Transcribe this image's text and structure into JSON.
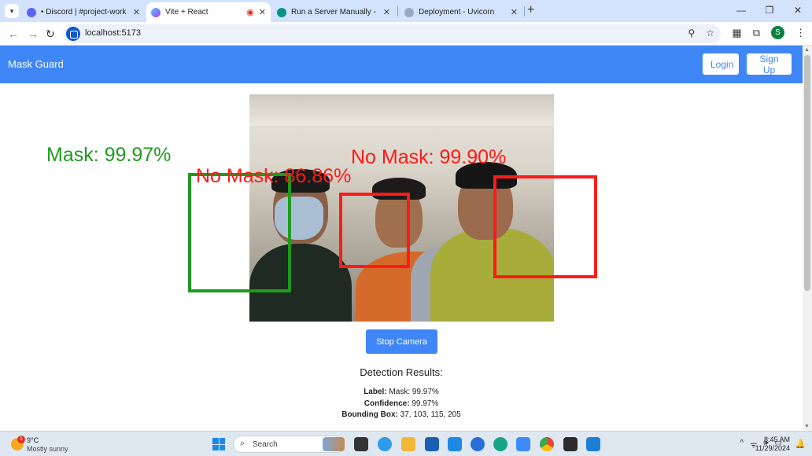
{
  "browser": {
    "tabs": [
      {
        "title": "• Discord | #project-work | SWE",
        "active": false
      },
      {
        "title": "Vite + React",
        "active": true
      },
      {
        "title": "Run a Server Manually - FastAPI",
        "active": false
      },
      {
        "title": "Deployment - Uvicorn",
        "active": false
      }
    ],
    "url": "localhost:5173",
    "profile_initial": "S"
  },
  "app": {
    "brand": "Mask Guard",
    "login_label": "Login",
    "signup_label": "Sign Up",
    "detections": [
      {
        "text": "Mask: 99.97%",
        "color": "#1f9a1f"
      },
      {
        "text": "No Mask: 86.86%",
        "color": "#ff1a1a"
      },
      {
        "text": "No Mask: 99.90%",
        "color": "#ff1a1a"
      }
    ],
    "stop_label": "Stop Camera",
    "results": {
      "title": "Detection Results:",
      "label_key": "Label:",
      "label_value": "Mask: 99.97%",
      "confidence_key": "Confidence:",
      "confidence_value": "99.97%",
      "bbox_key": "Bounding Box:",
      "bbox_value": "37, 103, 115, 205"
    }
  },
  "taskbar": {
    "temp": "9°C",
    "weather": "Mostly sunny",
    "weather_badge": "1",
    "search_placeholder": "Search",
    "time": "8:45 AM",
    "date": "11/29/2024"
  }
}
